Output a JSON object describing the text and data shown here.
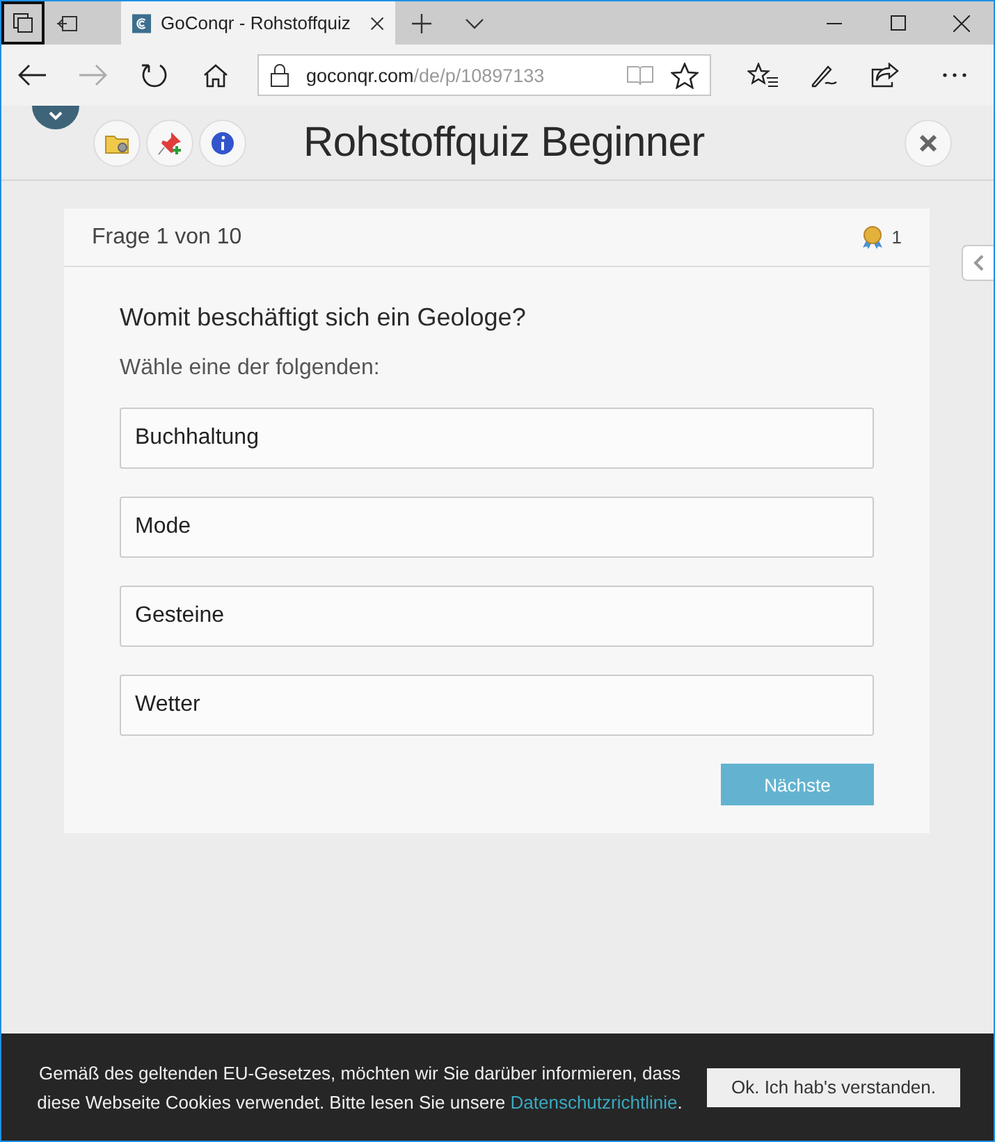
{
  "browser": {
    "tab_title": "GoConqr - Rohstoffquiz",
    "url_host": "goconqr.com",
    "url_path": "/de/p/10897133"
  },
  "quiz": {
    "title": "Rohstoffquiz Beginner",
    "question_counter": "Frage 1 von 10",
    "points": "1",
    "question": "Womit beschäftigt sich ein Geologe?",
    "instruction": "Wähle eine der folgenden:",
    "options": [
      {
        "label": "Buchhaltung",
        "selected": false
      },
      {
        "label": "Mode",
        "selected": false
      },
      {
        "label": "Gesteine",
        "selected": false
      },
      {
        "label": "Wetter",
        "selected": false
      }
    ],
    "next_button": "Nächste"
  },
  "cookie_bar": {
    "text_before": "Gemäß des geltenden EU-Gesetzes, möchten wir Sie darüber informieren, dass diese Webseite Cookies verwendet. Bitte lesen Sie unsere ",
    "link": "Datenschutzrichtlinie",
    "text_after": ".",
    "button": "Ok. Ich hab's verstanden."
  }
}
